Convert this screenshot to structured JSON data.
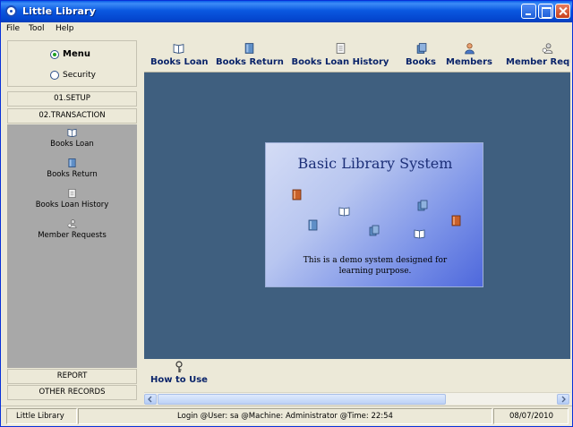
{
  "window": {
    "title": "Little Library"
  },
  "menu": [
    "File",
    "Tool",
    "Help"
  ],
  "mode": {
    "menu_label": "Menu",
    "security_label": "Security",
    "selected": "Menu"
  },
  "sections": {
    "setup": "01.SETUP",
    "transaction": "02.TRANSACTION",
    "report": "REPORT",
    "other": "OTHER RECORDS"
  },
  "nav_items": [
    {
      "label": "Books Loan",
      "icon": "open-book-icon"
    },
    {
      "label": "Books Return",
      "icon": "closed-book-icon"
    },
    {
      "label": "Books Loan History",
      "icon": "document-icon"
    },
    {
      "label": "Member Requests",
      "icon": "user-request-icon"
    }
  ],
  "toolbar": {
    "books_loan": "Books Loan",
    "books_return": "Books Return",
    "books_loan_history": "Books Loan History",
    "books": "Books",
    "members": "Members",
    "member_requests": "Member Requests"
  },
  "splash": {
    "title": "Basic Library System",
    "description": "This is a demo system designed for learning purpose."
  },
  "bottom": {
    "how_to_use": "How to Use"
  },
  "status": {
    "app": "Little Library",
    "login": "Login @User: sa  @Machine: Administrator  @Time: 22:54",
    "date": "08/07/2010"
  },
  "colors": {
    "titlebar": "#0a58e0",
    "canvas": "#3f5f7f",
    "nav_panel": "#a8a8a8",
    "toolbar_text": "#0a246a"
  }
}
